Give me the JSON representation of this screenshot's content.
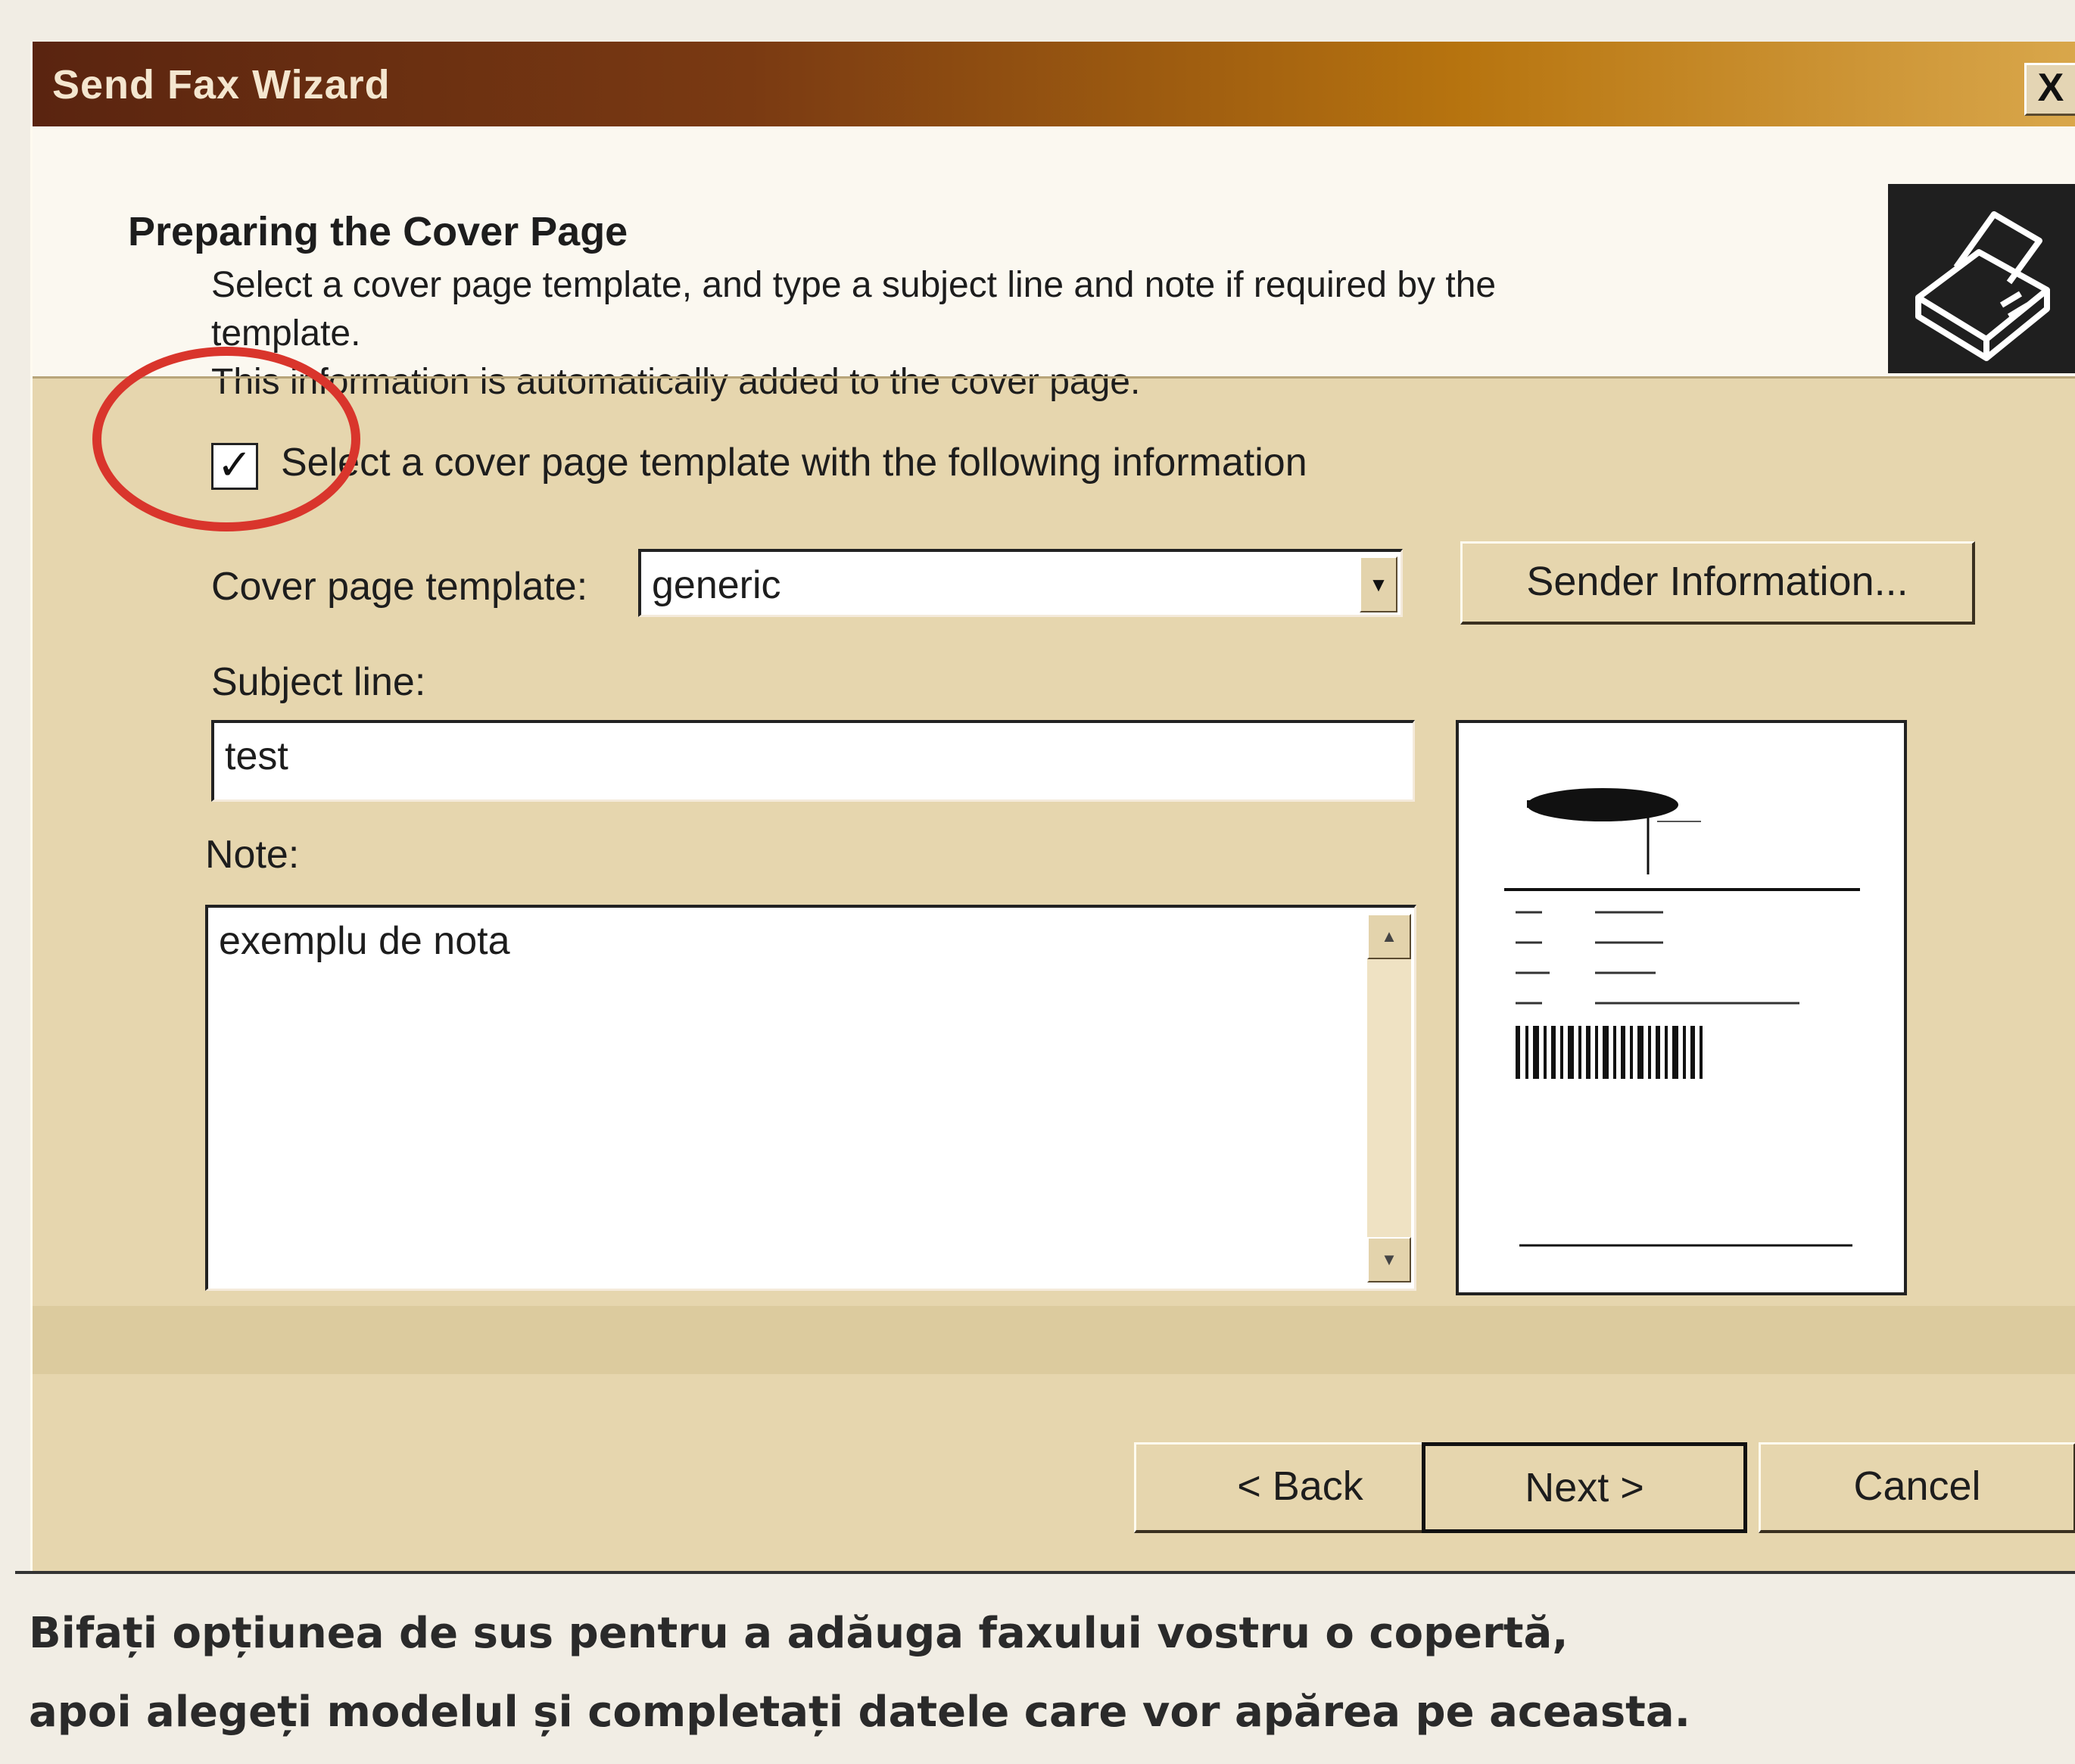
{
  "window": {
    "title": "Send Fax Wizard",
    "close_label": "X"
  },
  "header": {
    "title": "Preparing the Cover Page",
    "description_line1": "Select a cover page template, and type a subject line and note if required by the",
    "description_line2": "template.",
    "description_line3": "This information is automatically added to the cover page.",
    "icon": "fax-machine-icon"
  },
  "cover_option": {
    "checkbox_checked": true,
    "checkbox_label": "Select a cover page template with the following information"
  },
  "form": {
    "template_label": "Cover page template:",
    "template_value": "generic",
    "sender_info_button": "Sender Information...",
    "subject_label": "Subject line:",
    "subject_value": "test",
    "note_label": "Note:",
    "note_value": "exemplu de nota"
  },
  "buttons": {
    "back": "< Back",
    "next": "Next >",
    "cancel": "Cancel"
  },
  "caption": {
    "line1": "Bifați opțiunea de sus pentru a adăuga faxului vostru o copertă,",
    "line2": "apoi alegeți modelul și completați datele care vor apărea pe aceasta."
  },
  "colors": {
    "annotation": "#d9352c",
    "titlebar_start": "#5a2410",
    "titlebar_end": "#d9a74b",
    "dialog_face": "#e6d6ae"
  }
}
